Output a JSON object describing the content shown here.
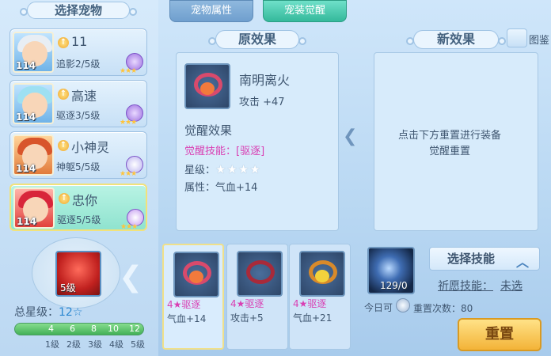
{
  "header": {
    "select_pet_title": "选择宠物",
    "tabs": [
      {
        "label": "宠物属性"
      },
      {
        "label": "宠装觉醒"
      }
    ],
    "help_label": "图鉴"
  },
  "pets": [
    {
      "level": "114",
      "name": "11",
      "skill": "追影2/5级"
    },
    {
      "level": "114",
      "name": "高速",
      "skill": "驱逐3/5级"
    },
    {
      "level": "114",
      "name": "小神灵",
      "skill": "神躯5/5级"
    },
    {
      "level": "114",
      "name": "忠你",
      "skill": "驱逐5/5级"
    }
  ],
  "equipment": {
    "level_label": "5级"
  },
  "star_summary": {
    "total_label": "总星级：",
    "total_value": "12",
    "ticks": [
      "4",
      "6",
      "8",
      "10",
      "12"
    ],
    "levels": [
      "1级",
      "2级",
      "3级",
      "4级",
      "5级"
    ]
  },
  "original_effect": {
    "title": "原效果",
    "item_name": "南明离火",
    "attack": "攻击 +47",
    "awaken_title": "觉醒效果",
    "awaken_skill": "觉醒技能：[驱逐]",
    "star_label": "星级：",
    "stars": "★★★★",
    "attr_label": "属性：气血+14"
  },
  "new_effect": {
    "title": "新效果",
    "hint_line1": "点击下方重置进行装备",
    "hint_line2": "觉醒重置"
  },
  "choices": [
    {
      "star_skill": "4★驱逐",
      "attr": "气血+14"
    },
    {
      "star_skill": "4★驱逐",
      "attr": "攻击+5"
    },
    {
      "star_skill": "4★驱逐",
      "attr": "气血+21"
    }
  ],
  "orb": {
    "count": "129/0"
  },
  "actions": {
    "select_skill_label": "选择技能",
    "wish_skill_label": "祈愿技能：",
    "wish_skill_value": "未选",
    "today_label": "今日可",
    "reset_count_label": "重置次数：80",
    "reset_button": "重置"
  }
}
